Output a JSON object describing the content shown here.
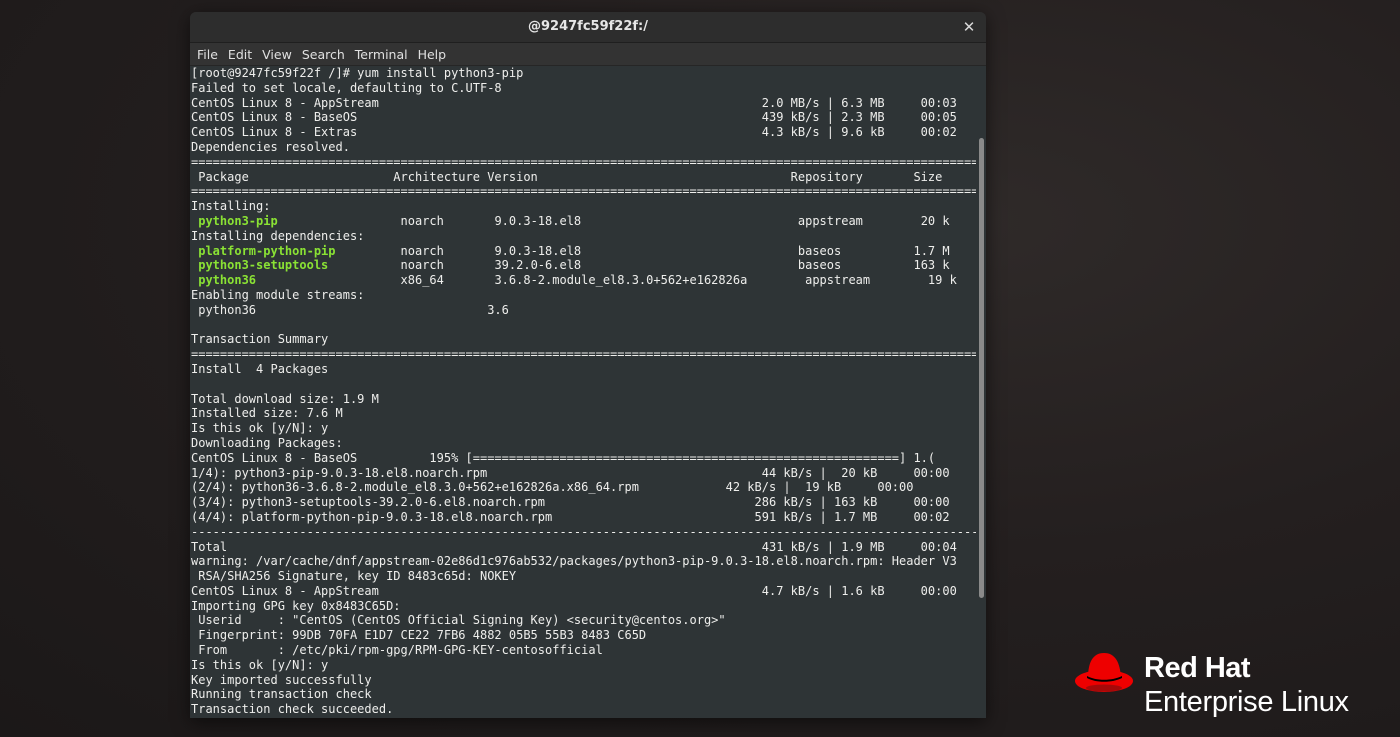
{
  "window": {
    "title": "@9247fc59f22f:/",
    "close_glyph": "✕"
  },
  "menu": [
    "File",
    "Edit",
    "View",
    "Search",
    "Terminal",
    "Help"
  ],
  "terminal_lines": [
    {
      "text": "[root@9247fc59f22f /]# yum install python3-pip"
    },
    {
      "text": "Failed to set locale, defaulting to C.UTF-8"
    },
    {
      "text": "CentOS Linux 8 - AppStream                                                     2.0 MB/s | 6.3 MB     00:03"
    },
    {
      "text": "CentOS Linux 8 - BaseOS                                                        439 kB/s | 2.3 MB     00:05"
    },
    {
      "text": "CentOS Linux 8 - Extras                                                        4.3 kB/s | 9.6 kB     00:02"
    },
    {
      "text": "Dependencies resolved."
    },
    {
      "text": "=============================================================================================================="
    },
    {
      "text": " Package                    Architecture Version                                   Repository       Size"
    },
    {
      "text": "=============================================================================================================="
    },
    {
      "text": "Installing:"
    },
    {
      "pkg": " python3-pip",
      "text": "                 noarch       9.0.3-18.el8                              appstream        20 k"
    },
    {
      "text": "Installing dependencies:"
    },
    {
      "pkg": " platform-python-pip",
      "text": "         noarch       9.0.3-18.el8                              baseos          1.7 M"
    },
    {
      "pkg": " python3-setuptools",
      "text": "          noarch       39.2.0-6.el8                              baseos          163 k"
    },
    {
      "pkg": " python36",
      "text": "                    x86_64       3.6.8-2.module_el8.3.0+562+e162826a        appstream        19 k"
    },
    {
      "text": "Enabling module streams:"
    },
    {
      "text": " python36                                3.6"
    },
    {
      "text": ""
    },
    {
      "text": "Transaction Summary"
    },
    {
      "text": "=============================================================================================================="
    },
    {
      "text": "Install  4 Packages"
    },
    {
      "text": ""
    },
    {
      "text": "Total download size: 1.9 M"
    },
    {
      "text": "Installed size: 7.6 M"
    },
    {
      "text": "Is this ok [y/N]: y"
    },
    {
      "text": "Downloading Packages:"
    },
    {
      "text": "CentOS Linux 8 - BaseOS          195% [===========================================================] 1.("
    },
    {
      "text": "1/4): python3-pip-9.0.3-18.el8.noarch.rpm                                      44 kB/s |  20 kB     00:00"
    },
    {
      "text": "(2/4): python36-3.6.8-2.module_el8.3.0+562+e162826a.x86_64.rpm            42 kB/s |  19 kB     00:00"
    },
    {
      "text": "(3/4): python3-setuptools-39.2.0-6.el8.noarch.rpm                             286 kB/s | 163 kB     00:00"
    },
    {
      "text": "(4/4): platform-python-pip-9.0.3-18.el8.noarch.rpm                            591 kB/s | 1.7 MB     00:02"
    },
    {
      "text": "--------------------------------------------------------------------------------------------------------------"
    },
    {
      "text": "Total                                                                          431 kB/s | 1.9 MB     00:04"
    },
    {
      "text": "warning: /var/cache/dnf/appstream-02e86d1c976ab532/packages/python3-pip-9.0.3-18.el8.noarch.rpm: Header V3"
    },
    {
      "text": " RSA/SHA256 Signature, key ID 8483c65d: NOKEY"
    },
    {
      "text": "CentOS Linux 8 - AppStream                                                     4.7 kB/s | 1.6 kB     00:00"
    },
    {
      "text": "Importing GPG key 0x8483C65D:"
    },
    {
      "text": " Userid     : \"CentOS (CentOS Official Signing Key) <security@centos.org>\""
    },
    {
      "text": " Fingerprint: 99DB 70FA E1D7 CE22 7FB6 4882 05B5 55B3 8483 C65D"
    },
    {
      "text": " From       : /etc/pki/rpm-gpg/RPM-GPG-KEY-centosofficial"
    },
    {
      "text": "Is this ok [y/N]: y"
    },
    {
      "text": "Key imported successfully"
    },
    {
      "text": "Running transaction check"
    },
    {
      "text": "Transaction check succeeded."
    }
  ],
  "brand": {
    "line1": "Red Hat",
    "line2": "Enterprise Linux",
    "hat_color": "#ee0000"
  },
  "colors": {
    "terminal_bg": "#2e3436",
    "terminal_fg": "#eeeeec",
    "package_green": "#8ae234"
  }
}
